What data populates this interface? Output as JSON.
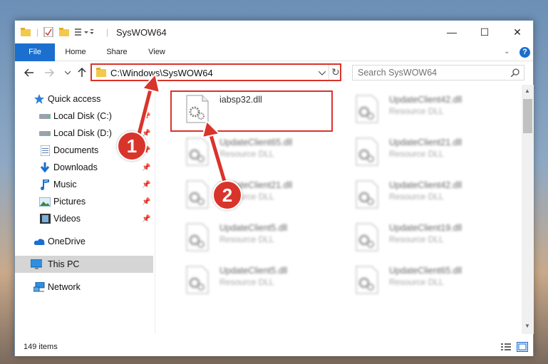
{
  "window": {
    "title": "SysWOW64",
    "controls": {
      "minimize": "—",
      "maximize": "☐",
      "close": "✕"
    }
  },
  "ribbon": {
    "tabs": [
      {
        "label": "File"
      },
      {
        "label": "Home"
      },
      {
        "label": "Share"
      },
      {
        "label": "View"
      }
    ],
    "help": "?"
  },
  "nav": {
    "address": "C:\\Windows\\SysWOW64",
    "search_placeholder": "Search SysWOW64"
  },
  "sidebar": {
    "items": [
      {
        "label": "Quick access",
        "icon": "star-icon"
      },
      {
        "label": "Local Disk (C:)",
        "icon": "drive-icon"
      },
      {
        "label": "Local Disk (D:)",
        "icon": "drive-icon"
      },
      {
        "label": "Documents",
        "icon": "documents-icon"
      },
      {
        "label": "Downloads",
        "icon": "download-arrow-icon"
      },
      {
        "label": "Music",
        "icon": "music-note-icon"
      },
      {
        "label": "Pictures",
        "icon": "pictures-icon"
      },
      {
        "label": "Videos",
        "icon": "film-icon"
      },
      {
        "label": "OneDrive",
        "icon": "cloud-icon"
      },
      {
        "label": "This PC",
        "icon": "monitor-icon"
      },
      {
        "label": "Network",
        "icon": "network-icon"
      }
    ]
  },
  "files": [
    {
      "name": "iabsp32.dll",
      "type": ""
    },
    {
      "name": "UpdateClient42.dll",
      "type": "Resource DLL"
    },
    {
      "name": "UpdateClient65.dll",
      "type": "Resource DLL"
    },
    {
      "name": "UpdateClient21.dll",
      "type": "Resource DLL"
    },
    {
      "name": "UpdateClient21.dll",
      "type": "Resource DLL"
    },
    {
      "name": "UpdateClient42.dll",
      "type": "Resource DLL"
    },
    {
      "name": "UpdateClient5.dll",
      "type": "Resource DLL"
    },
    {
      "name": "UpdateClient19.dll",
      "type": "Resource DLL"
    },
    {
      "name": "UpdateClient5.dll",
      "type": "Resource DLL"
    },
    {
      "name": "UpdateClient65.dll",
      "type": "Resource DLL"
    }
  ],
  "status": {
    "count": "149 items"
  },
  "annotations": {
    "step1": "1",
    "step2": "2"
  },
  "colors": {
    "accent": "#1a6fcf",
    "highlight": "#d9342b",
    "folder": "#f3c94b"
  }
}
